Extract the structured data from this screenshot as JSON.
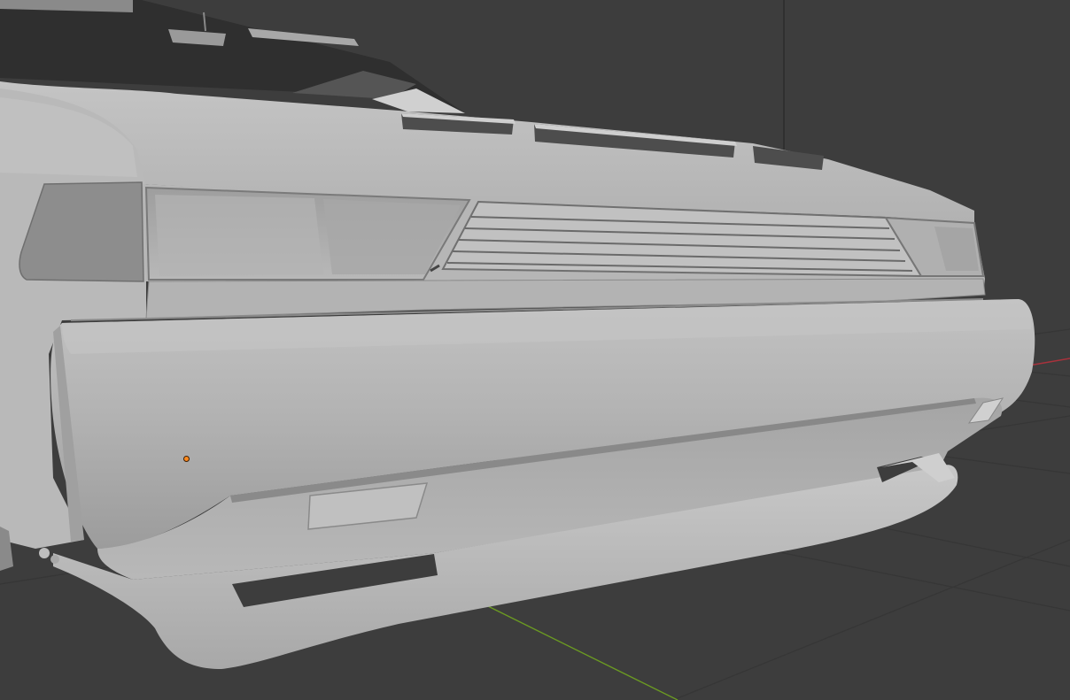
{
  "viewport": {
    "background_color": "#3d3d3d",
    "grid_color": "#353535",
    "x_axis_color": "#a8323c",
    "y_axis_color": "#6b9a22",
    "z_axis_color": "#2a2a2a"
  },
  "model": {
    "base_color": "#b4b4b4",
    "highlight_color": "#c6c6c6",
    "shadow_color": "#8e8e8e",
    "dark_color": "#4a4a4a"
  },
  "object_origin": {
    "color": "#ff8a1f",
    "icon": "object-origin-dot"
  }
}
